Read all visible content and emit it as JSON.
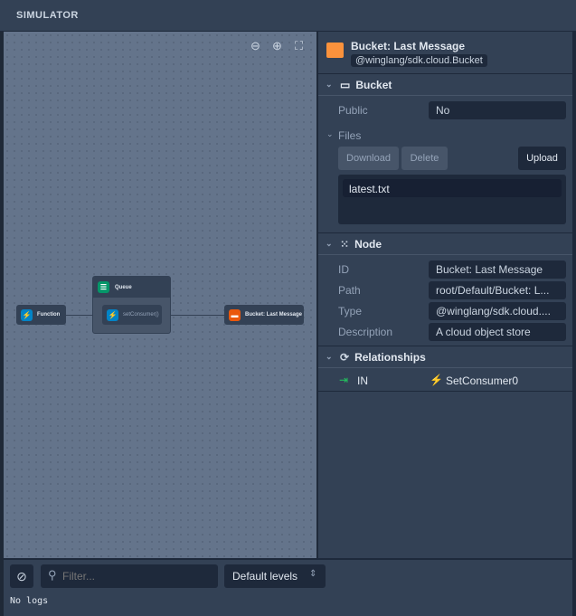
{
  "header": {
    "title": "SIMULATOR"
  },
  "canvas": {
    "nodes": {
      "function": "Function",
      "queue": "Queue",
      "set_consumer": "setConsumer()",
      "bucket": "Bucket: Last Message"
    }
  },
  "inspector": {
    "title": "Bucket: Last Message",
    "type_badge": "@winglang/sdk.cloud.Bucket",
    "bucket_section": {
      "title": "Bucket",
      "public_label": "Public",
      "public_value": "No",
      "files_label": "Files",
      "download": "Download",
      "delete": "Delete",
      "upload": "Upload",
      "files": [
        "latest.txt"
      ]
    },
    "node_section": {
      "title": "Node",
      "rows": [
        {
          "label": "ID",
          "value": "Bucket: Last Message"
        },
        {
          "label": "Path",
          "value": "root/Default/Bucket: L..."
        },
        {
          "label": "Type",
          "value": "@winglang/sdk.cloud...."
        },
        {
          "label": "Description",
          "value": "A cloud object store"
        }
      ]
    },
    "relationships": {
      "title": "Relationships",
      "items": [
        {
          "direction": "IN",
          "target": "SetConsumer0"
        }
      ]
    }
  },
  "logs": {
    "filter_placeholder": "Filter...",
    "level_select": "Default levels",
    "empty": "No logs"
  },
  "colors": {
    "function": "#0284c7",
    "queue": "#059669",
    "bucket": "#ea580c",
    "accent_green": "#22c55e",
    "accent_blue": "#38bdf8"
  }
}
